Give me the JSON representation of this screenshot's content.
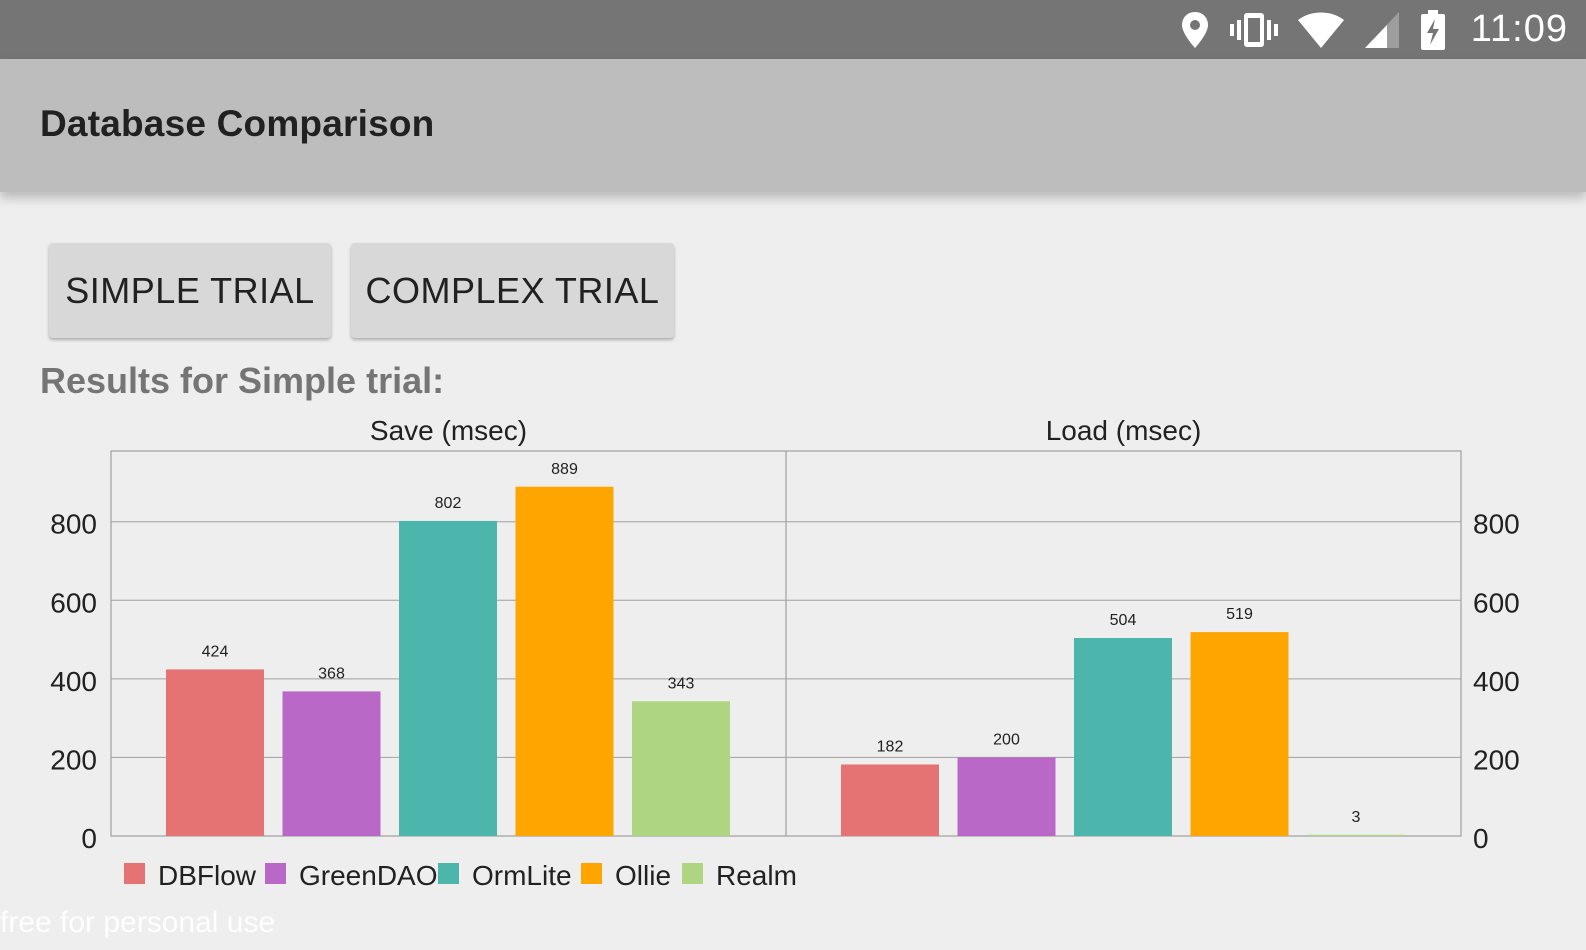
{
  "status_bar": {
    "time": "11:09",
    "icons": [
      "location-icon",
      "vibrate-icon",
      "wifi-icon",
      "cell-signal-icon",
      "battery-charging-icon"
    ]
  },
  "app_bar": {
    "title": "Database Comparison"
  },
  "buttons": {
    "simple": "SIMPLE TRIAL",
    "complex": "COMPLEX TRIAL"
  },
  "results_heading": "Results for Simple trial:",
  "watermark": "free for personal use",
  "colors": {
    "DBFlow": "#e57373",
    "GreenDAO": "#ba68c8",
    "OrmLite": "#4db6ac",
    "Ollie": "#ffa500",
    "Realm": "#aed581"
  },
  "chart_data": [
    {
      "type": "bar",
      "title": "Save (msec)",
      "categories": [
        "DBFlow",
        "GreenDAO",
        "OrmLite",
        "Ollie",
        "Realm"
      ],
      "values": [
        424,
        368,
        802,
        889,
        343
      ],
      "ylim": [
        0,
        980
      ],
      "yticks": [
        0,
        200,
        400,
        600,
        800
      ],
      "grid": true
    },
    {
      "type": "bar",
      "title": "Load (msec)",
      "categories": [
        "DBFlow",
        "GreenDAO",
        "OrmLite",
        "Ollie",
        "Realm"
      ],
      "values": [
        182,
        200,
        504,
        519,
        3
      ],
      "ylim": [
        0,
        980
      ],
      "yticks": [
        0,
        200,
        400,
        600,
        800
      ],
      "grid": true
    }
  ],
  "legend": [
    "DBFlow",
    "GreenDAO",
    "OrmLite",
    "Ollie",
    "Realm"
  ]
}
